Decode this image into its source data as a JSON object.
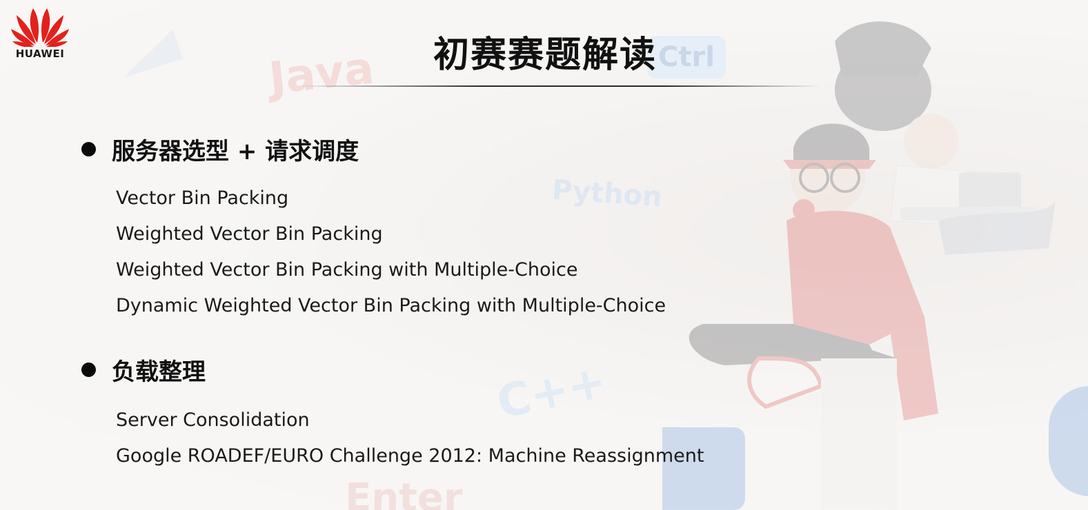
{
  "logo": {
    "brand": "HUAWEI",
    "icon": "huawei-petals-icon",
    "color": "#e3211c"
  },
  "title": "初赛赛题解读",
  "sections": [
    {
      "heading": "服务器选型 + 请求调度",
      "items": [
        "Vector Bin Packing",
        "Weighted Vector Bin Packing",
        "Weighted Vector Bin Packing with Multiple-Choice",
        "Dynamic Weighted Vector Bin Packing with Multiple-Choice"
      ]
    },
    {
      "heading": "负载整理",
      "items": [
        "Server Consolidation",
        "Google ROADEF/EURO Challenge 2012: Machine Reassignment"
      ]
    }
  ],
  "background_words": {
    "java": "Java",
    "ctrl": "Ctrl",
    "python": "Python",
    "cpp": "C++",
    "enter": "Enter"
  }
}
